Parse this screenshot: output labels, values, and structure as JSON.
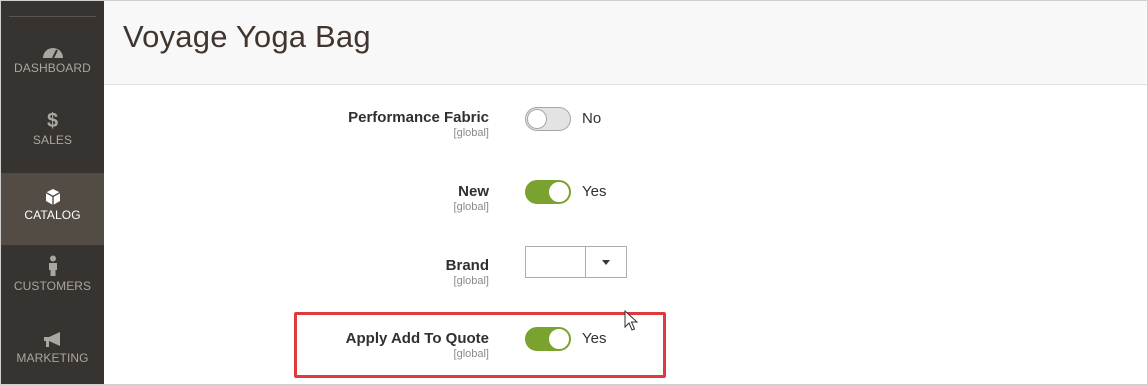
{
  "sidebar": {
    "items": [
      {
        "label": "DASHBOARD",
        "icon": "dashboard-icon"
      },
      {
        "label": "SALES",
        "icon": "dollar-icon"
      },
      {
        "label": "CATALOG",
        "icon": "cube-icon",
        "active": true
      },
      {
        "label": "CUSTOMERS",
        "icon": "person-icon"
      },
      {
        "label": "MARKETING",
        "icon": "megaphone-icon"
      }
    ]
  },
  "page": {
    "title": "Voyage Yoga Bag"
  },
  "fields": {
    "performance_fabric": {
      "label": "Performance Fabric",
      "scope": "[global]",
      "value": "No"
    },
    "new": {
      "label": "New",
      "scope": "[global]",
      "value": "Yes"
    },
    "brand": {
      "label": "Brand",
      "scope": "[global]",
      "value": ""
    },
    "apply_add_to_quote": {
      "label": "Apply Add To Quote",
      "scope": "[global]",
      "value": "Yes"
    }
  },
  "colors": {
    "toggle_on": "#79a22e",
    "highlight": "#e0393e",
    "sidebar_bg": "#373330",
    "sidebar_active": "#524c44"
  }
}
